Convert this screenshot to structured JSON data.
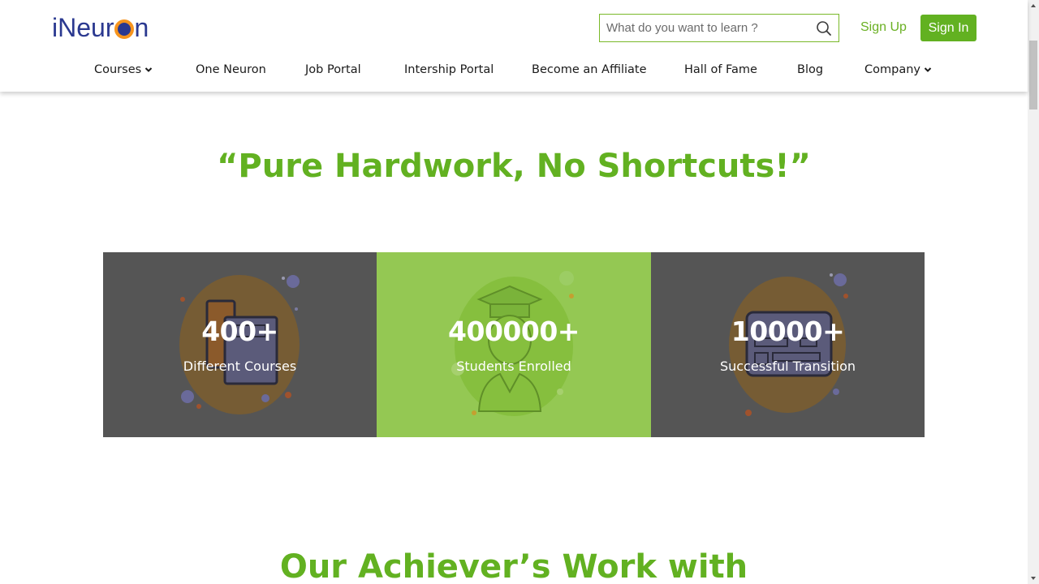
{
  "header": {
    "logo": {
      "part1": "iNeur",
      "part2": "n"
    },
    "search": {
      "placeholder": "What do you want to learn ?",
      "value": ""
    },
    "sign_up": "Sign Up",
    "sign_in": "Sign In"
  },
  "nav": {
    "items": [
      {
        "label": "Courses",
        "has_dropdown": true
      },
      {
        "label": "One Neuron",
        "has_dropdown": false
      },
      {
        "label": "Job Portal",
        "has_dropdown": false
      },
      {
        "label": "Intership Portal",
        "has_dropdown": false
      },
      {
        "label": "Become an Affiliate",
        "has_dropdown": false
      },
      {
        "label": "Hall of Fame",
        "has_dropdown": false
      },
      {
        "label": "Blog",
        "has_dropdown": false
      },
      {
        "label": "Company",
        "has_dropdown": true
      }
    ]
  },
  "main": {
    "quote": "“Pure Hardwork, No Shortcuts!”",
    "stats": [
      {
        "value": "400+",
        "label": "Different Courses",
        "icon": "books-icon"
      },
      {
        "value": "400000+",
        "label": "Students Enrolled",
        "icon": "graduate-icon"
      },
      {
        "value": "10000+",
        "label": "Successful Transition",
        "icon": "id-card-icon"
      }
    ],
    "next_heading": "Our Achiever’s Work with"
  },
  "colors": {
    "brand_green": "#62b121",
    "brand_blue": "#2b3990",
    "brand_orange": "#f7941d",
    "stat_dark": "#555555",
    "stat_green": "#94c853"
  }
}
